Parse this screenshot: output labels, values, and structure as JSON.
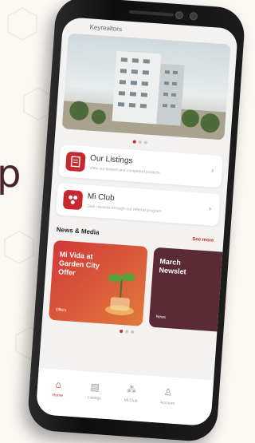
{
  "background": {
    "word": "p"
  },
  "app": {
    "header_text": "Keyrealtors"
  },
  "carousel": {
    "total": 3,
    "active": 0
  },
  "menu": [
    {
      "title": "Our Listings",
      "subtitle": "View our leased and completed projects",
      "icon": "listings-icon"
    },
    {
      "title": "Mi Club",
      "subtitle": "Gain rewards through our referral program",
      "icon": "club-icon"
    }
  ],
  "news_section": {
    "title": "News & Media",
    "see_more": "See more"
  },
  "news": [
    {
      "title": "Mi Vida at\nGarden City\nOffer",
      "tag": "Offers"
    },
    {
      "title": "March\nNewslet",
      "tag": "News"
    }
  ],
  "news_dots": {
    "total": 3,
    "active": 0
  },
  "tabs": [
    {
      "label": "Home",
      "icon": "home-icon",
      "active": true
    },
    {
      "label": "Listings",
      "icon": "listings-tab-icon",
      "active": false
    },
    {
      "label": "Mi Club",
      "icon": "club-tab-icon",
      "active": false
    },
    {
      "label": "Account",
      "icon": "account-icon",
      "active": false
    }
  ],
  "colors": {
    "accent": "#c8282d",
    "dark": "#4a2331"
  }
}
